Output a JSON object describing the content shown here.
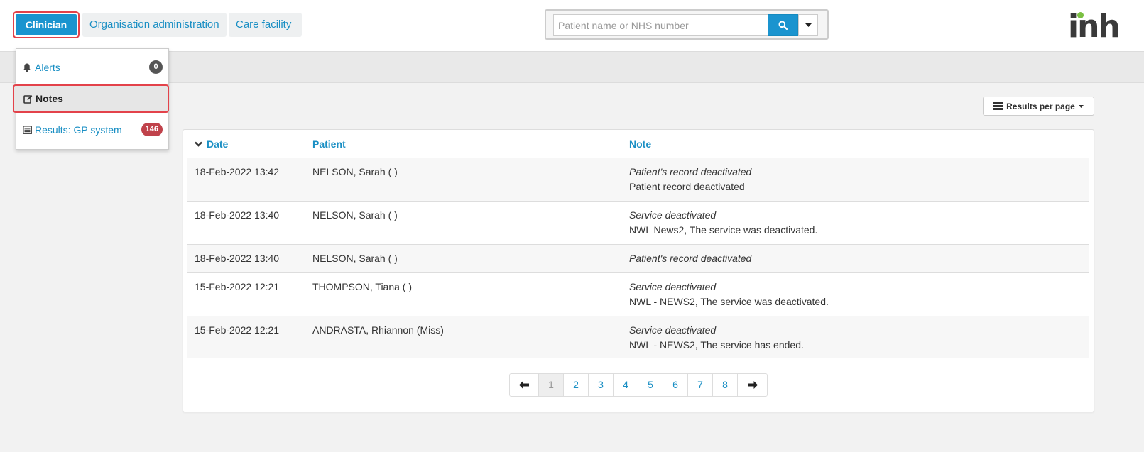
{
  "nav": {
    "clinician": "Clinician",
    "organisation_admin": "Organisation administration",
    "care_facility": "Care facility"
  },
  "search": {
    "placeholder": "Patient name or NHS number"
  },
  "logo": "inh",
  "menu": {
    "alerts": {
      "label": "Alerts",
      "count": "0"
    },
    "notes": {
      "label": "Notes"
    },
    "results": {
      "label": "Results: GP system",
      "count": "146"
    }
  },
  "results_per_page": "Results per page",
  "table": {
    "headers": {
      "date": "Date",
      "patient": "Patient",
      "note": "Note"
    },
    "rows": [
      {
        "date": "18-Feb-2022 13:42",
        "patient": "NELSON, Sarah ( )",
        "note_title": "Patient's record deactivated",
        "note_body": "Patient record deactivated"
      },
      {
        "date": "18-Feb-2022 13:40",
        "patient": "NELSON, Sarah ( )",
        "note_title": "Service deactivated",
        "note_body": "NWL News2, The service was deactivated."
      },
      {
        "date": "18-Feb-2022 13:40",
        "patient": "NELSON, Sarah ( )",
        "note_title": "Patient's record deactivated",
        "note_body": ""
      },
      {
        "date": "15-Feb-2022 12:21",
        "patient": "THOMPSON, Tiana ( )",
        "note_title": "Service deactivated",
        "note_body": "NWL - NEWS2, The service was deactivated."
      },
      {
        "date": "15-Feb-2022 12:21",
        "patient": "ANDRASTA, Rhiannon (Miss)",
        "note_title": "Service deactivated",
        "note_body": "NWL - NEWS2, The service has ended."
      }
    ]
  },
  "pagination": {
    "pages": [
      "1",
      "2",
      "3",
      "4",
      "5",
      "6",
      "7",
      "8"
    ],
    "current": "1"
  },
  "colors": {
    "accent": "#1a94cf",
    "highlight_border": "#e3424a",
    "badge_red": "#c0424b"
  }
}
